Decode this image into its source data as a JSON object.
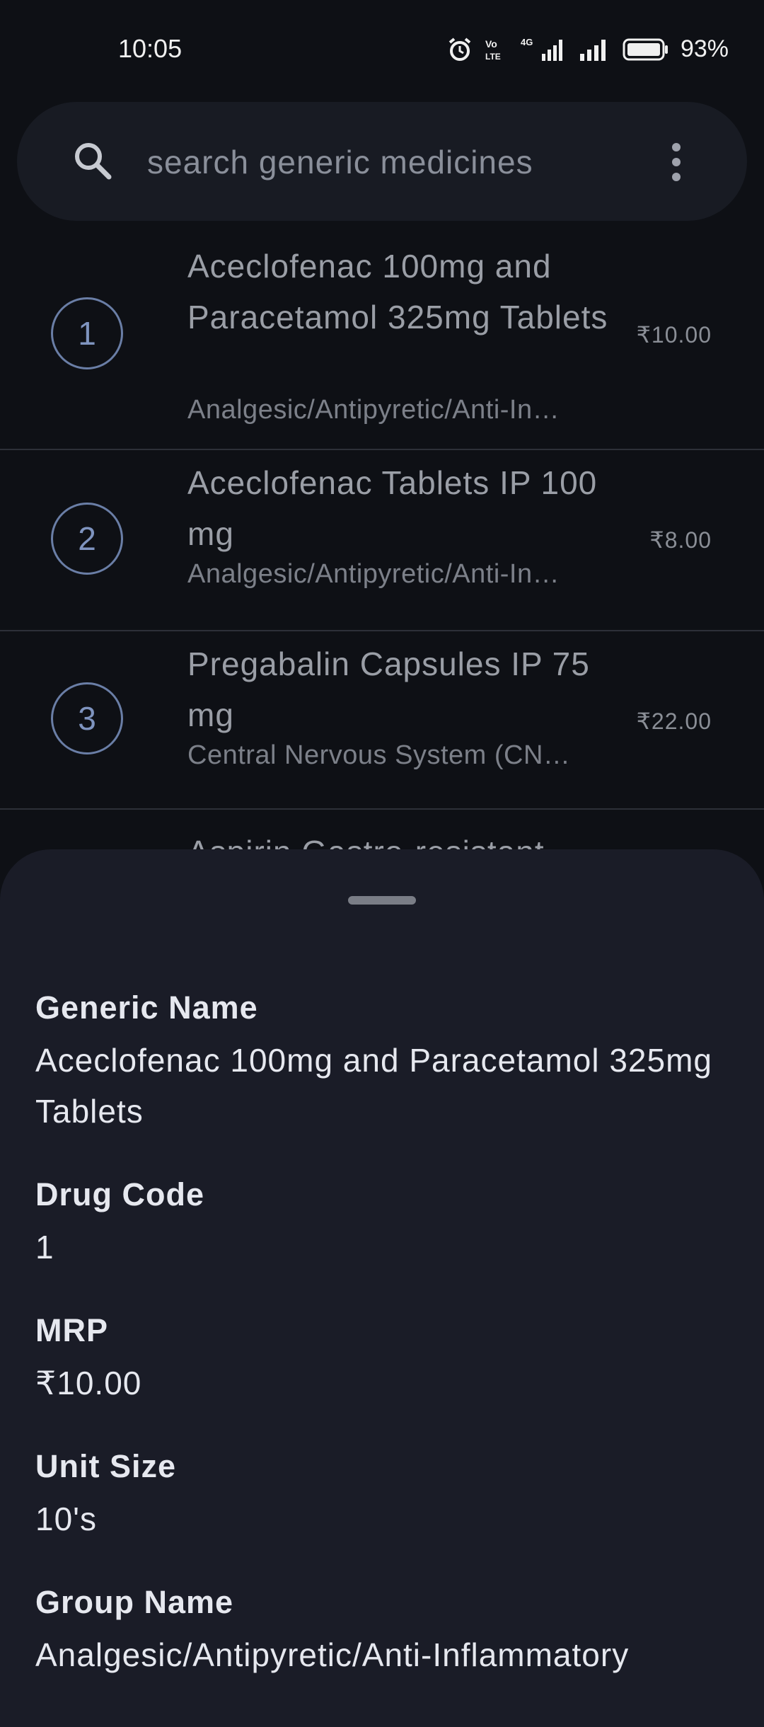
{
  "status_bar": {
    "time": "10:05",
    "network": "4G",
    "battery": "93%"
  },
  "search": {
    "placeholder": "search generic medicines"
  },
  "medicines": [
    {
      "index": "1",
      "name": "Aceclofenac 100mg and Paracetamol 325mg Tablets",
      "group": "Analgesic/Antipyretic/Anti-In…",
      "price": "₹10.00"
    },
    {
      "index": "2",
      "name": "Aceclofenac Tablets IP 100 mg",
      "group": "Analgesic/Antipyretic/Anti-In…",
      "price": "₹8.00"
    },
    {
      "index": "3",
      "name": "Pregabalin Capsules IP 75 mg",
      "group": "Central Nervous System (CN…",
      "price": "₹22.00"
    },
    {
      "name": "Aspirin Gastro-resistant"
    }
  ],
  "detail": {
    "generic_name_label": "Generic Name",
    "generic_name_value": "Aceclofenac 100mg and Paracetamol 325mg Tablets",
    "drug_code_label": "Drug Code",
    "drug_code_value": "1",
    "mrp_label": "MRP",
    "mrp_value": "₹10.00",
    "unit_size_label": "Unit Size",
    "unit_size_value": "10's",
    "group_name_label": "Group Name",
    "group_name_value": "Analgesic/Antipyretic/Anti-Inflammatory"
  },
  "icons": {
    "search": "search-icon",
    "more": "more-vert-icon",
    "alarm": "alarm-icon",
    "volte": "volte-icon",
    "signal": "signal-icon",
    "battery": "battery-icon"
  }
}
